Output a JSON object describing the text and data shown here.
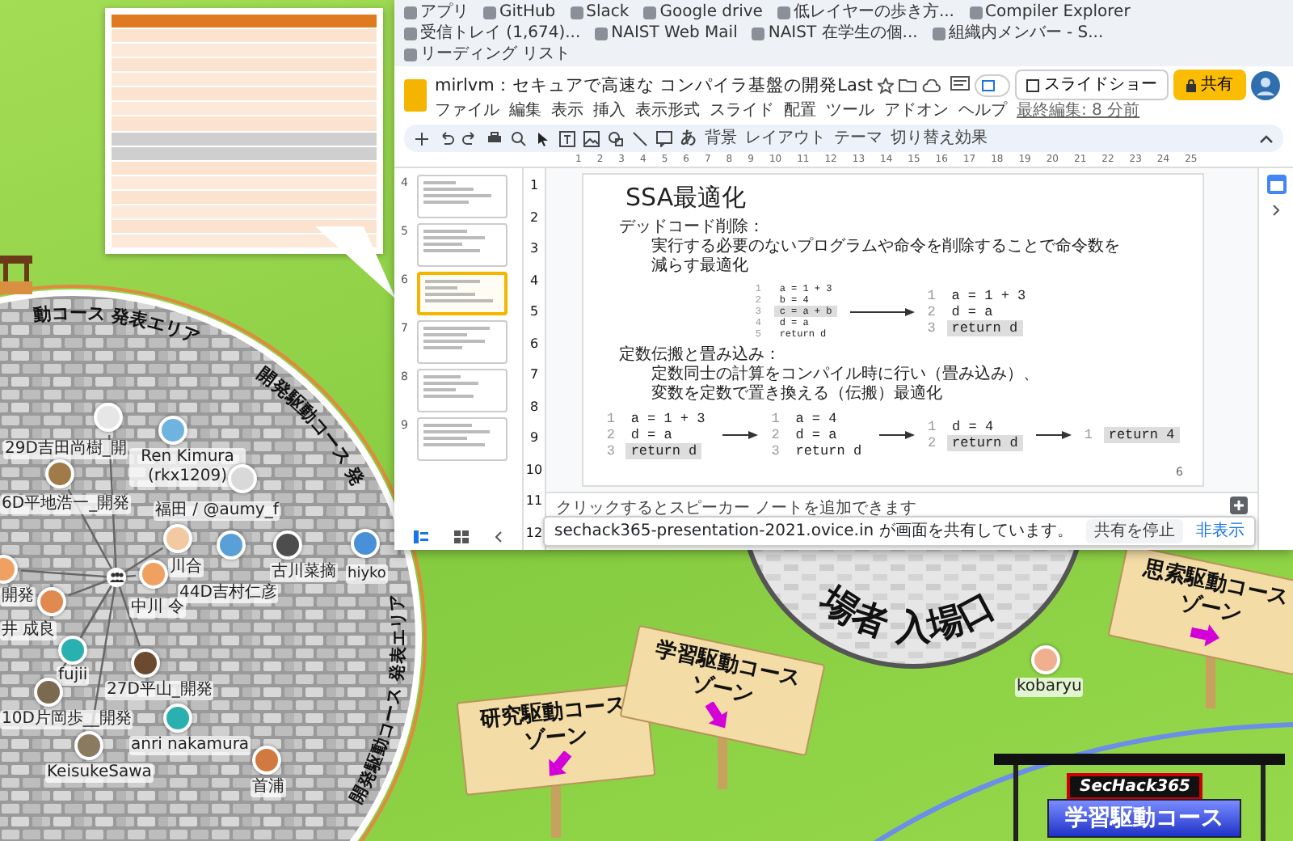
{
  "bookmarks": [
    "アプリ",
    "GitHub",
    "Slack",
    "Google drive",
    "低レイヤーの歩き方...",
    "Compiler Explorer",
    "受信トレイ (1,674)...",
    "NAIST Web Mail",
    "NAIST 在学生の個...",
    "組織内メンバー - S...",
    "リーディング リスト"
  ],
  "slides_app": {
    "title": "mirlvm：セキュアで高速な コンパイラ基盤の開発Last",
    "menu": [
      "ファイル",
      "編集",
      "表示",
      "挿入",
      "表示形式",
      "スライド",
      "配置",
      "ツール",
      "アドオン",
      "ヘルプ"
    ],
    "last_edit": "最終編集: 8 分前",
    "slideshow_button": "スライドショー",
    "share_button": "共有",
    "toolbar": {
      "ime": "あ",
      "buttons": [
        "背景",
        "レイアウト",
        "テーマ",
        "切り替え効果"
      ]
    },
    "ruler": {
      "h_marks": [
        "1",
        "2",
        "3",
        "4",
        "5",
        "6",
        "7",
        "8",
        "9",
        "10",
        "11",
        "12",
        "13",
        "14",
        "15",
        "16",
        "17",
        "18",
        "19",
        "20",
        "21",
        "22",
        "23",
        "24",
        "25"
      ],
      "v_marks": [
        "1",
        "2",
        "3",
        "4",
        "5",
        "6",
        "7",
        "8",
        "9",
        "10",
        "11",
        "12"
      ]
    },
    "thumbnails": [
      {
        "number": "4",
        "selected": false
      },
      {
        "number": "5",
        "selected": false
      },
      {
        "number": "6",
        "selected": true
      },
      {
        "number": "7",
        "selected": false
      },
      {
        "number": "8",
        "selected": false
      },
      {
        "number": "9",
        "selected": false
      }
    ],
    "slide": {
      "title": "SSA最適化",
      "sections": [
        {
          "heading": "デッドコード削除：",
          "lines": [
            "実行する必要のないプログラムや命令を削除することで命令数を",
            "減らす最適化"
          ],
          "code_row": [
            {
              "kind": "small",
              "lines": [
                {
                  "no": "1",
                  "code": "a = 1 + 3",
                  "highlight": false
                },
                {
                  "no": "2",
                  "code": "b = 4",
                  "highlight": false
                },
                {
                  "no": "3",
                  "code": "c = a + b",
                  "highlight": true
                },
                {
                  "no": "4",
                  "code": "d = a",
                  "highlight": false
                },
                {
                  "no": "5",
                  "code": "return d",
                  "highlight": false
                }
              ]
            },
            {
              "kind": "large",
              "lines": [
                {
                  "no": "1",
                  "code": "a = 1 + 3",
                  "highlight": false
                },
                {
                  "no": "2",
                  "code": "d = a",
                  "highlight": false
                },
                {
                  "no": "3",
                  "code": "return d",
                  "highlight": true
                }
              ]
            }
          ]
        },
        {
          "heading": "定数伝搬と畳み込み：",
          "lines": [
            "定数同士の計算をコンパイル時に行い（畳み込み）、",
            "変数を定数で置き換える（伝搬）最適化"
          ],
          "code_row": [
            {
              "kind": "large",
              "lines": [
                {
                  "no": "1",
                  "code": "a = 1 + 3",
                  "highlight": false
                },
                {
                  "no": "2",
                  "code": "d = a",
                  "highlight": false
                },
                {
                  "no": "3",
                  "code": "return d",
                  "highlight": true
                }
              ]
            },
            {
              "kind": "large",
              "lines": [
                {
                  "no": "1",
                  "code": "a = 4",
                  "highlight": false
                },
                {
                  "no": "2",
                  "code": "d = a",
                  "highlight": false
                },
                {
                  "no": "3",
                  "code": "return d",
                  "highlight": false
                }
              ]
            },
            {
              "kind": "large",
              "lines": [
                {
                  "no": "1",
                  "code": "d = 4",
                  "highlight": false
                },
                {
                  "no": "2",
                  "code": "return d",
                  "highlight": true
                }
              ]
            },
            {
              "kind": "large",
              "lines": [
                {
                  "no": "1",
                  "code": "return 4",
                  "highlight": true
                }
              ]
            }
          ]
        }
      ],
      "page_number": "6"
    },
    "speaker_notes": {
      "placeholder": "クリックするとスピーカー ノートを追加できます"
    }
  },
  "share_bar": {
    "message": "sechack365-presentation-2021.ovice.in が画面を共有しています。",
    "stop_button": "共有を停止",
    "hide_button": "非表示"
  },
  "map": {
    "area_labels": [
      "動コース 発表エリア",
      "開発駆動コース 発",
      "開発駆動コース 発表エリア"
    ],
    "users": [
      {
        "name": "29D吉田尚樹_開",
        "color": "#e6e6e6",
        "in_group": true
      },
      {
        "name": "Ren Kimura (rkx1209)",
        "color": "#6fb3e0",
        "in_group": false
      },
      {
        "name": "6D平地浩一_開発",
        "color": "#a07a48",
        "in_group": true
      },
      {
        "name": "福田 / @aumy_f",
        "color": "#d9d9d9",
        "in_group": false
      },
      {
        "name": "川合",
        "color": "#f2c9a0",
        "in_group": true
      },
      {
        "name": "44D吉村仁彦",
        "color": "#5aa0d8",
        "in_group": false
      },
      {
        "name": "古川菜摘",
        "color": "#4d4d4d",
        "in_group": false
      },
      {
        "name": "hiyko",
        "color": "#4a90d9",
        "in_group": false
      },
      {
        "name": "中川 令",
        "color": "#f0a060",
        "in_group": true
      },
      {
        "name": "開発",
        "color": "#f0a060",
        "in_group": true
      },
      {
        "name": "井 成良",
        "color": "#e08a50",
        "in_group": true
      },
      {
        "name": "fujii",
        "color": "#2bb0b0",
        "in_group": true
      },
      {
        "name": "10D片岡歩__開発",
        "color": "#7a6a50",
        "in_group": true
      },
      {
        "name": "27D平山_開発",
        "color": "#6b4a30",
        "in_group": true
      },
      {
        "name": "anri nakamura",
        "color": "#2bb0b0",
        "in_group": false
      },
      {
        "name": "KeisukeSawa",
        "color": "#8a7a60",
        "in_group": true
      },
      {
        "name": "首浦",
        "color": "#d07a40",
        "in_group": false
      },
      {
        "name": "kobaryu",
        "color": "#f0b090",
        "in_group": false
      }
    ],
    "entrance_label": "場者 入場口",
    "signs": [
      {
        "lines": [
          "研究駆動コース",
          "ゾーン"
        ],
        "kind": "down-left"
      },
      {
        "lines": [
          "学習駆動コース",
          "ゾーン"
        ],
        "kind": "down-right"
      },
      {
        "lines": [
          "思索駆動コース",
          "ゾーン"
        ],
        "kind": "right"
      }
    ],
    "stage": {
      "logo": "SecHack365",
      "banner": "学習駆動コース"
    }
  }
}
